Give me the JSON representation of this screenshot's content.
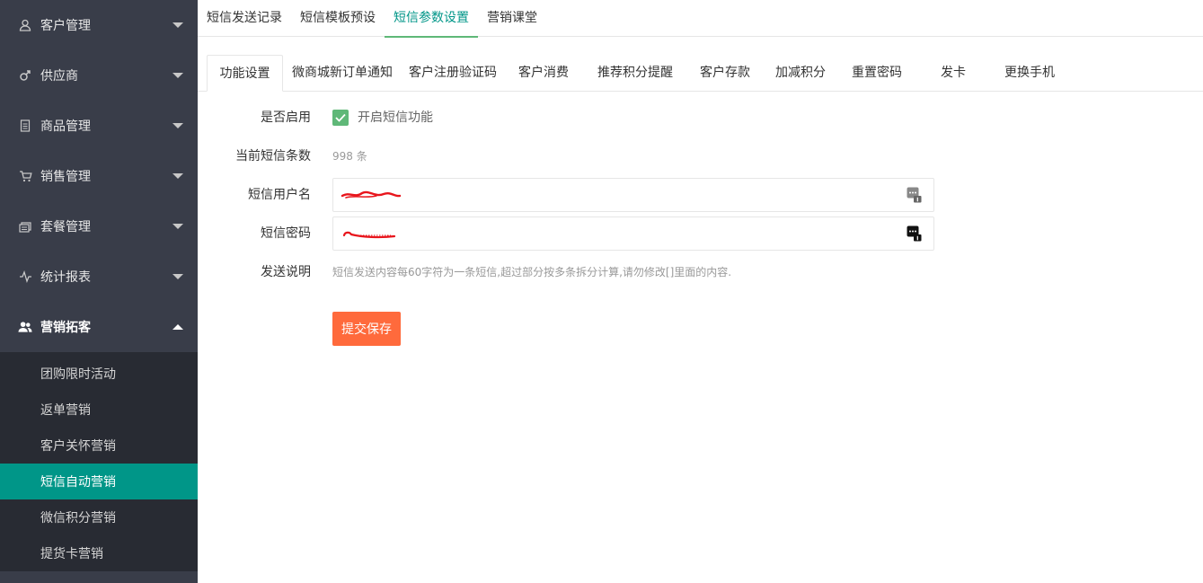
{
  "sidebar": {
    "items": [
      {
        "label": "客户管理",
        "icon": "user-icon"
      },
      {
        "label": "供应商",
        "icon": "male-icon"
      },
      {
        "label": "商品管理",
        "icon": "document-icon"
      },
      {
        "label": "销售管理",
        "icon": "cart-icon"
      },
      {
        "label": "套餐管理",
        "icon": "package-icon"
      },
      {
        "label": "统计报表",
        "icon": "pulse-icon"
      },
      {
        "label": "营销拓客",
        "icon": "users-icon"
      }
    ],
    "subitems": [
      {
        "label": "团购限时活动"
      },
      {
        "label": "返单营销"
      },
      {
        "label": "客户关怀营销"
      },
      {
        "label": "短信自动营销"
      },
      {
        "label": "微信积分营销"
      },
      {
        "label": "提货卡营销"
      }
    ]
  },
  "top_tabs": [
    "短信发送记录",
    "短信模板预设",
    "短信参数设置",
    "营销课堂"
  ],
  "card_tabs": [
    "功能设置",
    "微商城新订单通知",
    "客户注册验证码",
    "客户消费",
    "推荐积分提醒",
    "客户存款",
    "加减积分",
    "重置密码",
    "发卡",
    "更换手机"
  ],
  "form": {
    "enable_label": "是否启用",
    "enable_checkbox_text": "开启短信功能",
    "count_label": "当前短信条数",
    "count_value": "998 条",
    "username_label": "短信用户名",
    "password_label": "短信密码",
    "note_label": "发送说明",
    "note_text": "短信发送内容每60字符为一条短信,超过部分按多条拆分计算,请勿修改[]里面的内容.",
    "submit_label": "提交保存"
  },
  "colors": {
    "sidebar_bg": "#393d49",
    "subnav_bg": "#282b33",
    "active_teal": "#009688",
    "checkbox_green": "#5fb878",
    "submit_orange": "#ff6a3c",
    "redaction_red": "#e8151c"
  }
}
